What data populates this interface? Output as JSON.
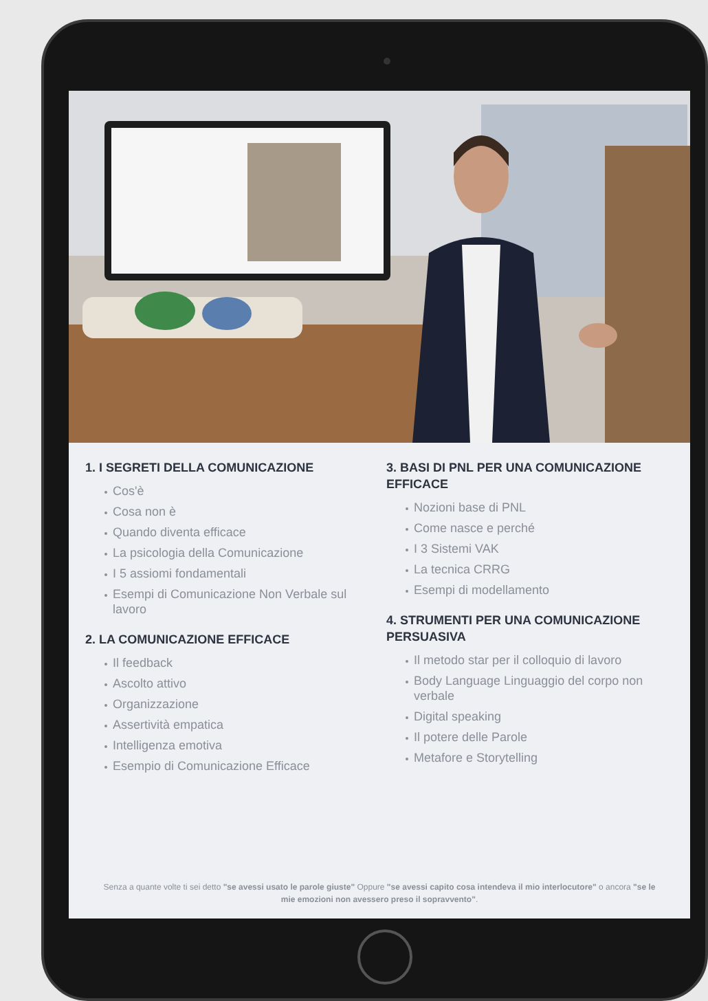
{
  "columns": [
    {
      "sections": [
        {
          "title": "1. I SEGRETI DELLA COMUNICAZIONE",
          "items": [
            "Cos'è",
            "Cosa non è",
            "Quando diventa efficace",
            "La psicologia della Comunicazione",
            "I 5 assiomi fondamentali",
            "Esempi di Comunicazione Non Verbale sul lavoro"
          ]
        },
        {
          "title": "2. LA COMUNICAZIONE EFFICACE",
          "items": [
            "Il feedback",
            "Ascolto attivo",
            "Organizzazione",
            "Assertività empatica",
            "Intelligenza emotiva",
            "Esempio di Comunicazione Efficace"
          ]
        }
      ]
    },
    {
      "sections": [
        {
          "title": "3. BASI DI PNL PER UNA COMUNICAZIONE EFFICACE",
          "items": [
            "Nozioni base di PNL",
            "Come nasce e perché",
            "I 3 Sistemi VAK",
            "La tecnica CRRG",
            "Esempi di modellamento"
          ]
        },
        {
          "title": "4. STRUMENTI PER UNA COMUNICAZIONE PERSUASIVA",
          "items": [
            "Il metodo star per il colloquio di lavoro",
            "Body Language Linguaggio del corpo non verbale",
            "Digital speaking",
            "Il potere delle Parole",
            "Metafore e Storytelling"
          ]
        }
      ]
    }
  ],
  "footer_note": "Senza a quante volte ti sei detto **\"se avessi usato le parole giuste\"** Oppure **\"se avessi capito cosa intendeva il mio interlocutore\"** o ancora **\"se le mie emozioni non avessero preso il sopravvento\"**."
}
